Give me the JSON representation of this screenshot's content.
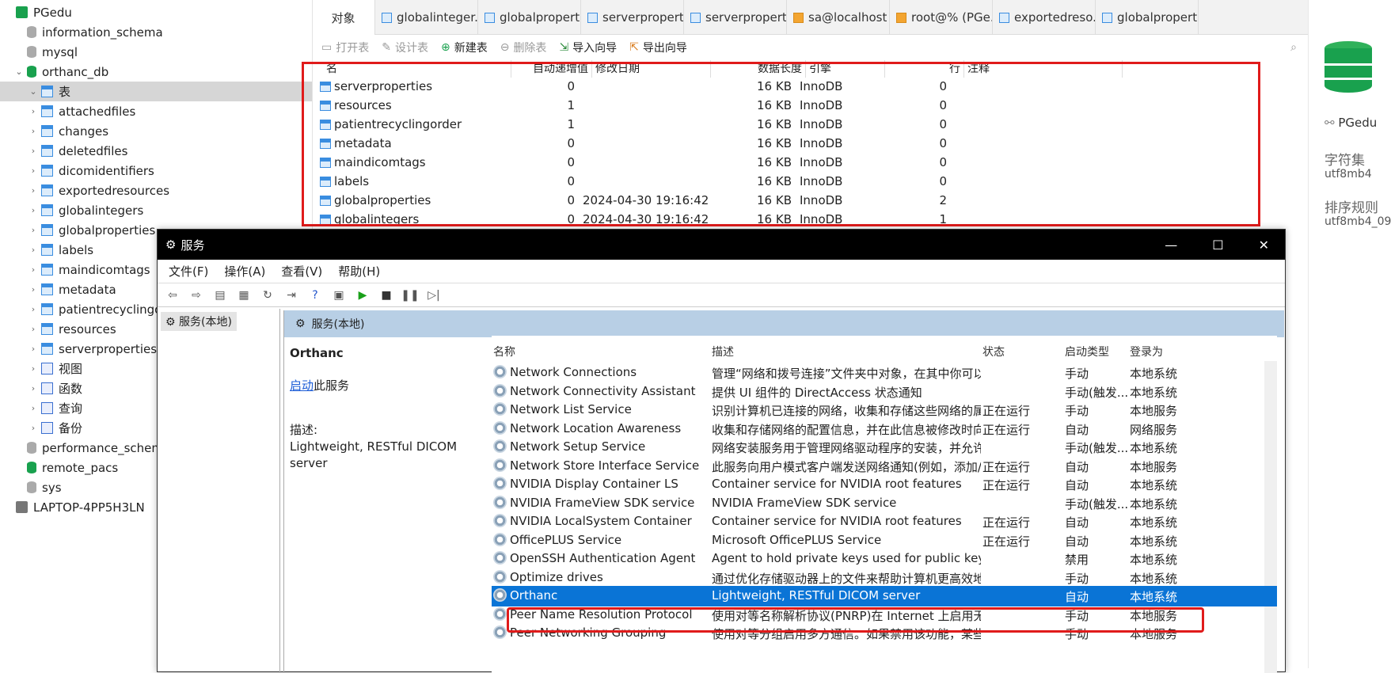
{
  "tree": {
    "items": [
      {
        "label": "PGedu",
        "depth": 0,
        "arrow": "",
        "icon": "server-icon",
        "color": "#19a14e"
      },
      {
        "label": "information_schema",
        "depth": 1,
        "arrow": "",
        "icon": "database-icon-gray"
      },
      {
        "label": "mysql",
        "depth": 1,
        "arrow": "",
        "icon": "database-icon-gray"
      },
      {
        "label": "orthanc_db",
        "depth": 1,
        "arrow": "v",
        "icon": "database-icon-green"
      },
      {
        "label": "表",
        "depth": 2,
        "arrow": "v",
        "icon": "tables-folder-icon",
        "selected": true
      },
      {
        "label": "attachedfiles",
        "depth": 3,
        "arrow": ">",
        "icon": "table-icon"
      },
      {
        "label": "changes",
        "depth": 3,
        "arrow": ">",
        "icon": "table-icon"
      },
      {
        "label": "deletedfiles",
        "depth": 3,
        "arrow": ">",
        "icon": "table-icon"
      },
      {
        "label": "dicomidentifiers",
        "depth": 3,
        "arrow": ">",
        "icon": "table-icon"
      },
      {
        "label": "exportedresources",
        "depth": 3,
        "arrow": ">",
        "icon": "table-icon"
      },
      {
        "label": "globalintegers",
        "depth": 3,
        "arrow": ">",
        "icon": "table-icon"
      },
      {
        "label": "globalproperties",
        "depth": 3,
        "arrow": ">",
        "icon": "table-icon"
      },
      {
        "label": "labels",
        "depth": 3,
        "arrow": ">",
        "icon": "table-icon"
      },
      {
        "label": "maindicomtags",
        "depth": 3,
        "arrow": ">",
        "icon": "table-icon"
      },
      {
        "label": "metadata",
        "depth": 3,
        "arrow": ">",
        "icon": "table-icon"
      },
      {
        "label": "patientrecyclingo",
        "depth": 3,
        "arrow": ">",
        "icon": "table-icon"
      },
      {
        "label": "resources",
        "depth": 3,
        "arrow": ">",
        "icon": "table-icon"
      },
      {
        "label": "serverproperties",
        "depth": 3,
        "arrow": ">",
        "icon": "table-icon"
      },
      {
        "label": "视图",
        "depth": 2,
        "arrow": ">",
        "icon": "view-icon"
      },
      {
        "label": "函数",
        "depth": 2,
        "arrow": ">",
        "icon": "function-icon"
      },
      {
        "label": "查询",
        "depth": 2,
        "arrow": ">",
        "icon": "query-icon"
      },
      {
        "label": "备份",
        "depth": 2,
        "arrow": ">",
        "icon": "backup-icon"
      },
      {
        "label": "performance_schema",
        "depth": 1,
        "arrow": "",
        "icon": "database-icon-gray"
      },
      {
        "label": "remote_pacs",
        "depth": 1,
        "arrow": "",
        "icon": "database-icon-green"
      },
      {
        "label": "sys",
        "depth": 1,
        "arrow": "",
        "icon": "database-icon-gray"
      },
      {
        "label": "LAPTOP-4PP5H3LN",
        "depth": 0,
        "arrow": "",
        "icon": "server-icon"
      }
    ]
  },
  "tabs": [
    {
      "label": "对象",
      "active": true
    },
    {
      "label": "globalinteger..."
    },
    {
      "label": "globalpropert..."
    },
    {
      "label": "serverpropert..."
    },
    {
      "label": "serverpropert..."
    },
    {
      "label": "sa@localhost ..."
    },
    {
      "label": "root@% (PGe..."
    },
    {
      "label": "exportedreso..."
    },
    {
      "label": "globalpropert..."
    }
  ],
  "toolbar": {
    "open": "打开表",
    "design": "设计表",
    "new": "新建表",
    "delete": "删除表",
    "import": "导入向导",
    "export": "导出向导"
  },
  "grid": {
    "headers": [
      "名",
      "自动递增值",
      "修改日期",
      "数据长度",
      "引擎",
      "行",
      "注释"
    ],
    "rows": [
      [
        "serverproperties",
        "0",
        "",
        "16 KB",
        "InnoDB",
        "0"
      ],
      [
        "resources",
        "1",
        "",
        "16 KB",
        "InnoDB",
        "0"
      ],
      [
        "patientrecyclingorder",
        "1",
        "",
        "16 KB",
        "InnoDB",
        "0"
      ],
      [
        "metadata",
        "0",
        "",
        "16 KB",
        "InnoDB",
        "0"
      ],
      [
        "maindicomtags",
        "0",
        "",
        "16 KB",
        "InnoDB",
        "0"
      ],
      [
        "labels",
        "0",
        "",
        "16 KB",
        "InnoDB",
        "0"
      ],
      [
        "globalproperties",
        "0",
        "2024-04-30 19:16:42",
        "16 KB",
        "InnoDB",
        "2"
      ],
      [
        "globalintegers",
        "0",
        "2024-04-30 19:16:42",
        "16 KB",
        "InnoDB",
        "1"
      ]
    ]
  },
  "side": {
    "server": "PGedu",
    "charset_label": "字符集",
    "charset": "utf8mb4",
    "collation_label": "排序规则",
    "collation": "utf8mb4_09"
  },
  "services": {
    "title": "服务",
    "menu": [
      "文件(F)",
      "操作(A)",
      "查看(V)",
      "帮助(H)"
    ],
    "tree_label": "服务(本地)",
    "header": "服务(本地)",
    "selected_name": "Orthanc",
    "start_link": "启动",
    "start_suffix": "此服务",
    "desc_label": "描述:",
    "desc_text": "Lightweight, RESTful DICOM server",
    "columns": [
      "名称",
      "描述",
      "状态",
      "启动类型",
      "登录为"
    ],
    "rows": [
      [
        "Network Connections",
        "管理“网络和拨号连接”文件夹中对象，在其中你可以查...",
        "",
        "手动",
        "本地系统"
      ],
      [
        "Network Connectivity Assistant",
        "提供 UI 组件的 DirectAccess 状态通知",
        "",
        "手动(触发...",
        "本地系统"
      ],
      [
        "Network List Service",
        "识别计算机已连接的网络，收集和存储这些网络的属...",
        "正在运行",
        "手动",
        "本地服务"
      ],
      [
        "Network Location Awareness",
        "收集和存储网络的配置信息，并在此信息被修改时向...",
        "正在运行",
        "自动",
        "网络服务"
      ],
      [
        "Network Setup Service",
        "网络安装服务用于管理网络驱动程序的安装，并允许...",
        "",
        "手动(触发...",
        "本地系统"
      ],
      [
        "Network Store Interface Service",
        "此服务向用户模式客户端发送网络通知(例如，添加/删...",
        "正在运行",
        "自动",
        "本地服务"
      ],
      [
        "NVIDIA Display Container LS",
        "Container service for NVIDIA root features",
        "正在运行",
        "自动",
        "本地系统"
      ],
      [
        "NVIDIA FrameView SDK service",
        "NVIDIA FrameView SDK service",
        "",
        "手动(触发...",
        "本地系统"
      ],
      [
        "NVIDIA LocalSystem Container",
        "Container service for NVIDIA root features",
        "正在运行",
        "自动",
        "本地系统"
      ],
      [
        "OfficePLUS Service",
        "Microsoft OfficePLUS Service",
        "正在运行",
        "自动",
        "本地系统"
      ],
      [
        "OpenSSH Authentication Agent",
        "Agent to hold private keys used for public key authe...",
        "",
        "禁用",
        "本地系统"
      ],
      [
        "Optimize drives",
        "通过优化存储驱动器上的文件来帮助计算机更高效地...",
        "",
        "手动",
        "本地系统"
      ],
      [
        "Orthanc",
        "Lightweight, RESTful DICOM server",
        "",
        "自动",
        "本地系统"
      ],
      [
        "Peer Name Resolution Protocol",
        "使用对等名称解析协议(PNRP)在 Internet 上启用无服...",
        "",
        "手动",
        "本地服务"
      ],
      [
        "Peer Networking Grouping",
        "使用对等分组启用多方通信。如果禁用该功能，某些...",
        "",
        "手动",
        "本地服务"
      ]
    ],
    "selected_index": 12
  },
  "colors": {
    "highlight": "#e01b1b",
    "selection": "#0a74d6"
  }
}
